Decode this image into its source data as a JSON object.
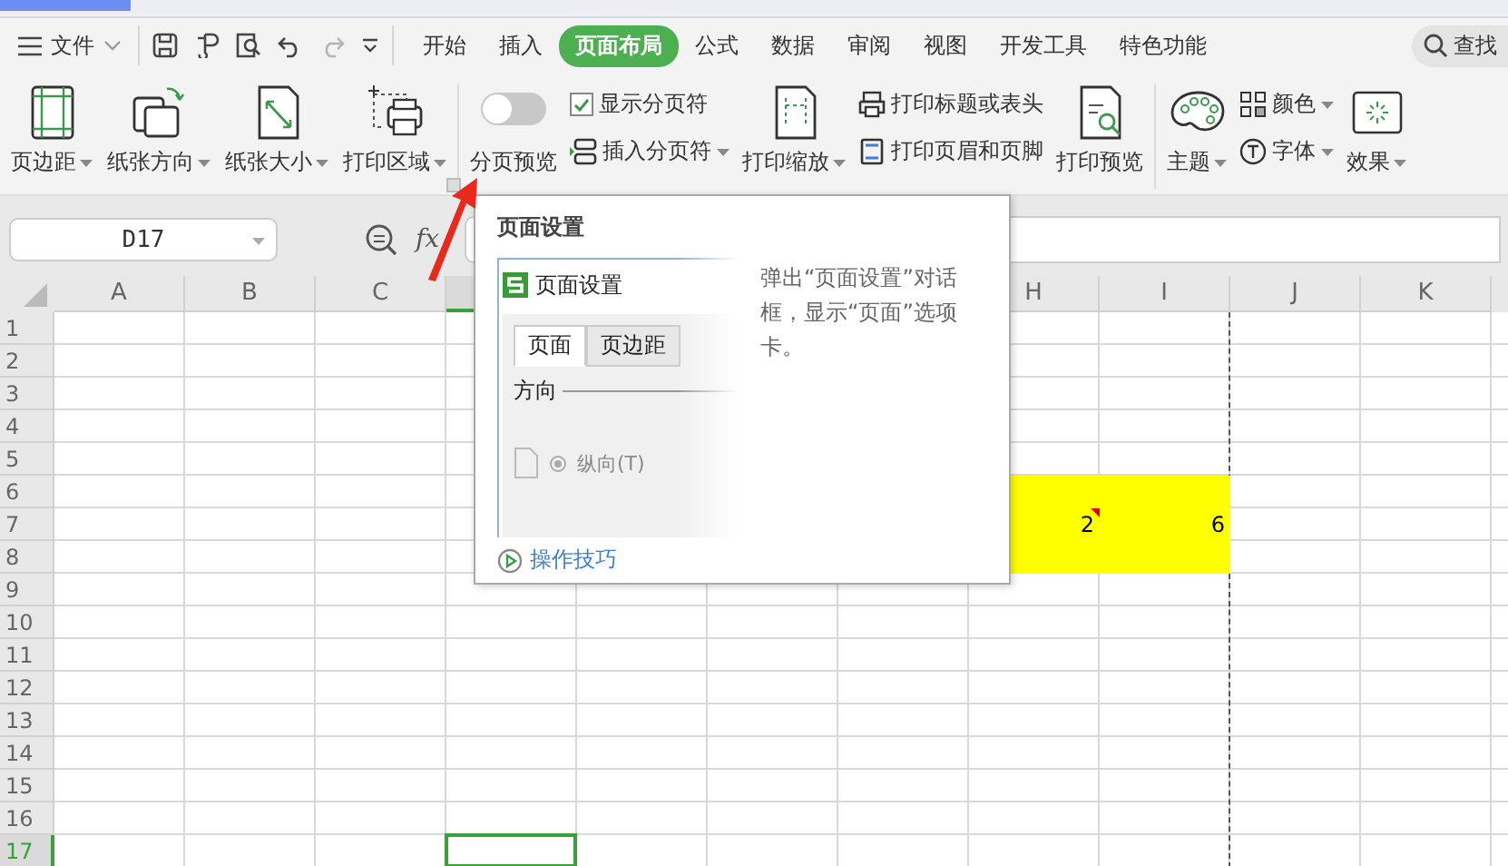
{
  "menu": {
    "file": "文件",
    "quick_access": [
      {
        "kind": "save",
        "disabled": false
      },
      {
        "kind": "painter",
        "disabled": false
      },
      {
        "kind": "preview",
        "disabled": false
      },
      {
        "kind": "undo",
        "disabled": false
      },
      {
        "kind": "redo",
        "disabled": true
      },
      {
        "kind": "more",
        "disabled": false
      }
    ],
    "tabs": [
      {
        "label": "开始",
        "selected": false
      },
      {
        "label": "插入",
        "selected": false
      },
      {
        "label": "页面布局",
        "selected": true
      },
      {
        "label": "公式",
        "selected": false
      },
      {
        "label": "数据",
        "selected": false
      },
      {
        "label": "审阅",
        "selected": false
      },
      {
        "label": "视图",
        "selected": false
      },
      {
        "label": "开发工具",
        "selected": false
      },
      {
        "label": "特色功能",
        "selected": false
      }
    ],
    "search": "查找"
  },
  "ribbon": [
    [
      {
        "kind": "large",
        "label": "页边距",
        "dropdown": true
      },
      {
        "kind": "large",
        "label": "纸张方向",
        "dropdown": true
      },
      {
        "kind": "large",
        "label": "纸张大小",
        "dropdown": true
      },
      {
        "kind": "large",
        "label": "打印区域",
        "dropdown": true,
        "launcher": true
      }
    ],
    [
      {
        "kind": "toggle",
        "label": "分页预览",
        "on": false
      },
      {
        "kind": "stack",
        "items": [
          {
            "kind": "check",
            "label": "显示分页符",
            "checked": true,
            "dropdown": false
          },
          {
            "kind": "small",
            "label": "插入分页符",
            "dropdown": true
          }
        ]
      },
      {
        "kind": "large",
        "label": "打印缩放",
        "dropdown": true
      },
      {
        "kind": "stack",
        "items": [
          {
            "kind": "small",
            "label": "打印标题或表头",
            "dropdown": false
          },
          {
            "kind": "small",
            "label": "打印页眉和页脚",
            "dropdown": false
          }
        ]
      },
      {
        "kind": "large",
        "label": "打印预览",
        "dropdown": false
      }
    ],
    [
      {
        "kind": "large",
        "label": "主题",
        "dropdown": true
      },
      {
        "kind": "stack",
        "items": [
          {
            "kind": "small",
            "label": "颜色",
            "dropdown": true
          },
          {
            "kind": "small",
            "label": "字体",
            "dropdown": true
          }
        ]
      },
      {
        "kind": "large",
        "label": "效果",
        "dropdown": true
      }
    ]
  ],
  "name_box": "D17",
  "function_label": "fx",
  "columns_left": [
    {
      "label": "A",
      "selected": false
    },
    {
      "label": "B",
      "selected": false
    },
    {
      "label": "C",
      "selected": false
    },
    {
      "selected": true
    }
  ],
  "columns_right": [
    {
      "label": "H",
      "page_break": false
    },
    {
      "label": "I",
      "page_break": true
    },
    {
      "label": "J",
      "page_break": false
    },
    {
      "label": "K",
      "page_break": false
    }
  ],
  "rows": [
    {
      "label": "1",
      "selected": false
    },
    {
      "label": "2",
      "selected": false
    },
    {
      "label": "3",
      "selected": false
    },
    {
      "label": "4",
      "selected": false
    },
    {
      "label": "5",
      "selected": false
    },
    {
      "label": "6",
      "selected": false,
      "cells_right": [
        {
          "highlighted": true,
          "comment": false
        },
        {
          "highlighted": true,
          "comment": false
        },
        {
          "highlighted": false,
          "comment": false
        },
        {
          "highlighted": false,
          "comment": false
        }
      ]
    },
    {
      "label": "7",
      "selected": false,
      "cells_right": [
        {
          "value": "2",
          "highlighted": true,
          "comment": true
        },
        {
          "value": "6",
          "highlighted": true,
          "comment": false
        },
        {
          "highlighted": false,
          "comment": false
        },
        {
          "highlighted": false,
          "comment": false
        }
      ]
    },
    {
      "label": "8",
      "selected": false,
      "cells_right": [
        {
          "highlighted": true,
          "comment": false
        },
        {
          "highlighted": true,
          "comment": false
        },
        {
          "highlighted": false,
          "comment": false
        },
        {
          "highlighted": false,
          "comment": false
        }
      ]
    },
    {
      "label": "9",
      "selected": false
    },
    {
      "label": "10",
      "selected": false
    },
    {
      "label": "11",
      "selected": false
    },
    {
      "label": "12",
      "selected": false
    },
    {
      "label": "13",
      "selected": false
    },
    {
      "label": "14",
      "selected": false
    },
    {
      "label": "15",
      "selected": false
    },
    {
      "label": "16",
      "selected": false
    },
    {
      "label": "17",
      "selected": true,
      "cells": [
        {
          "selected": false
        },
        {
          "selected": false
        },
        {
          "selected": false
        },
        {
          "selected": true
        },
        {
          "selected": false
        },
        {
          "selected": false
        },
        {
          "selected": false
        },
        {
          "selected": false
        },
        {
          "selected": false
        },
        {
          "selected": false
        },
        {
          "selected": false
        }
      ]
    }
  ],
  "tooltip": {
    "title": "页面设置",
    "preview": {
      "title": "页面设置",
      "tabs": [
        {
          "label": "页面",
          "selected": true
        },
        {
          "label": "页边距",
          "selected": false
        }
      ],
      "section": "方向",
      "option": "纵向(T)"
    },
    "description": "弹出“页面设置”对话框，显示“页面”选项卡。",
    "link": "操作技巧"
  }
}
